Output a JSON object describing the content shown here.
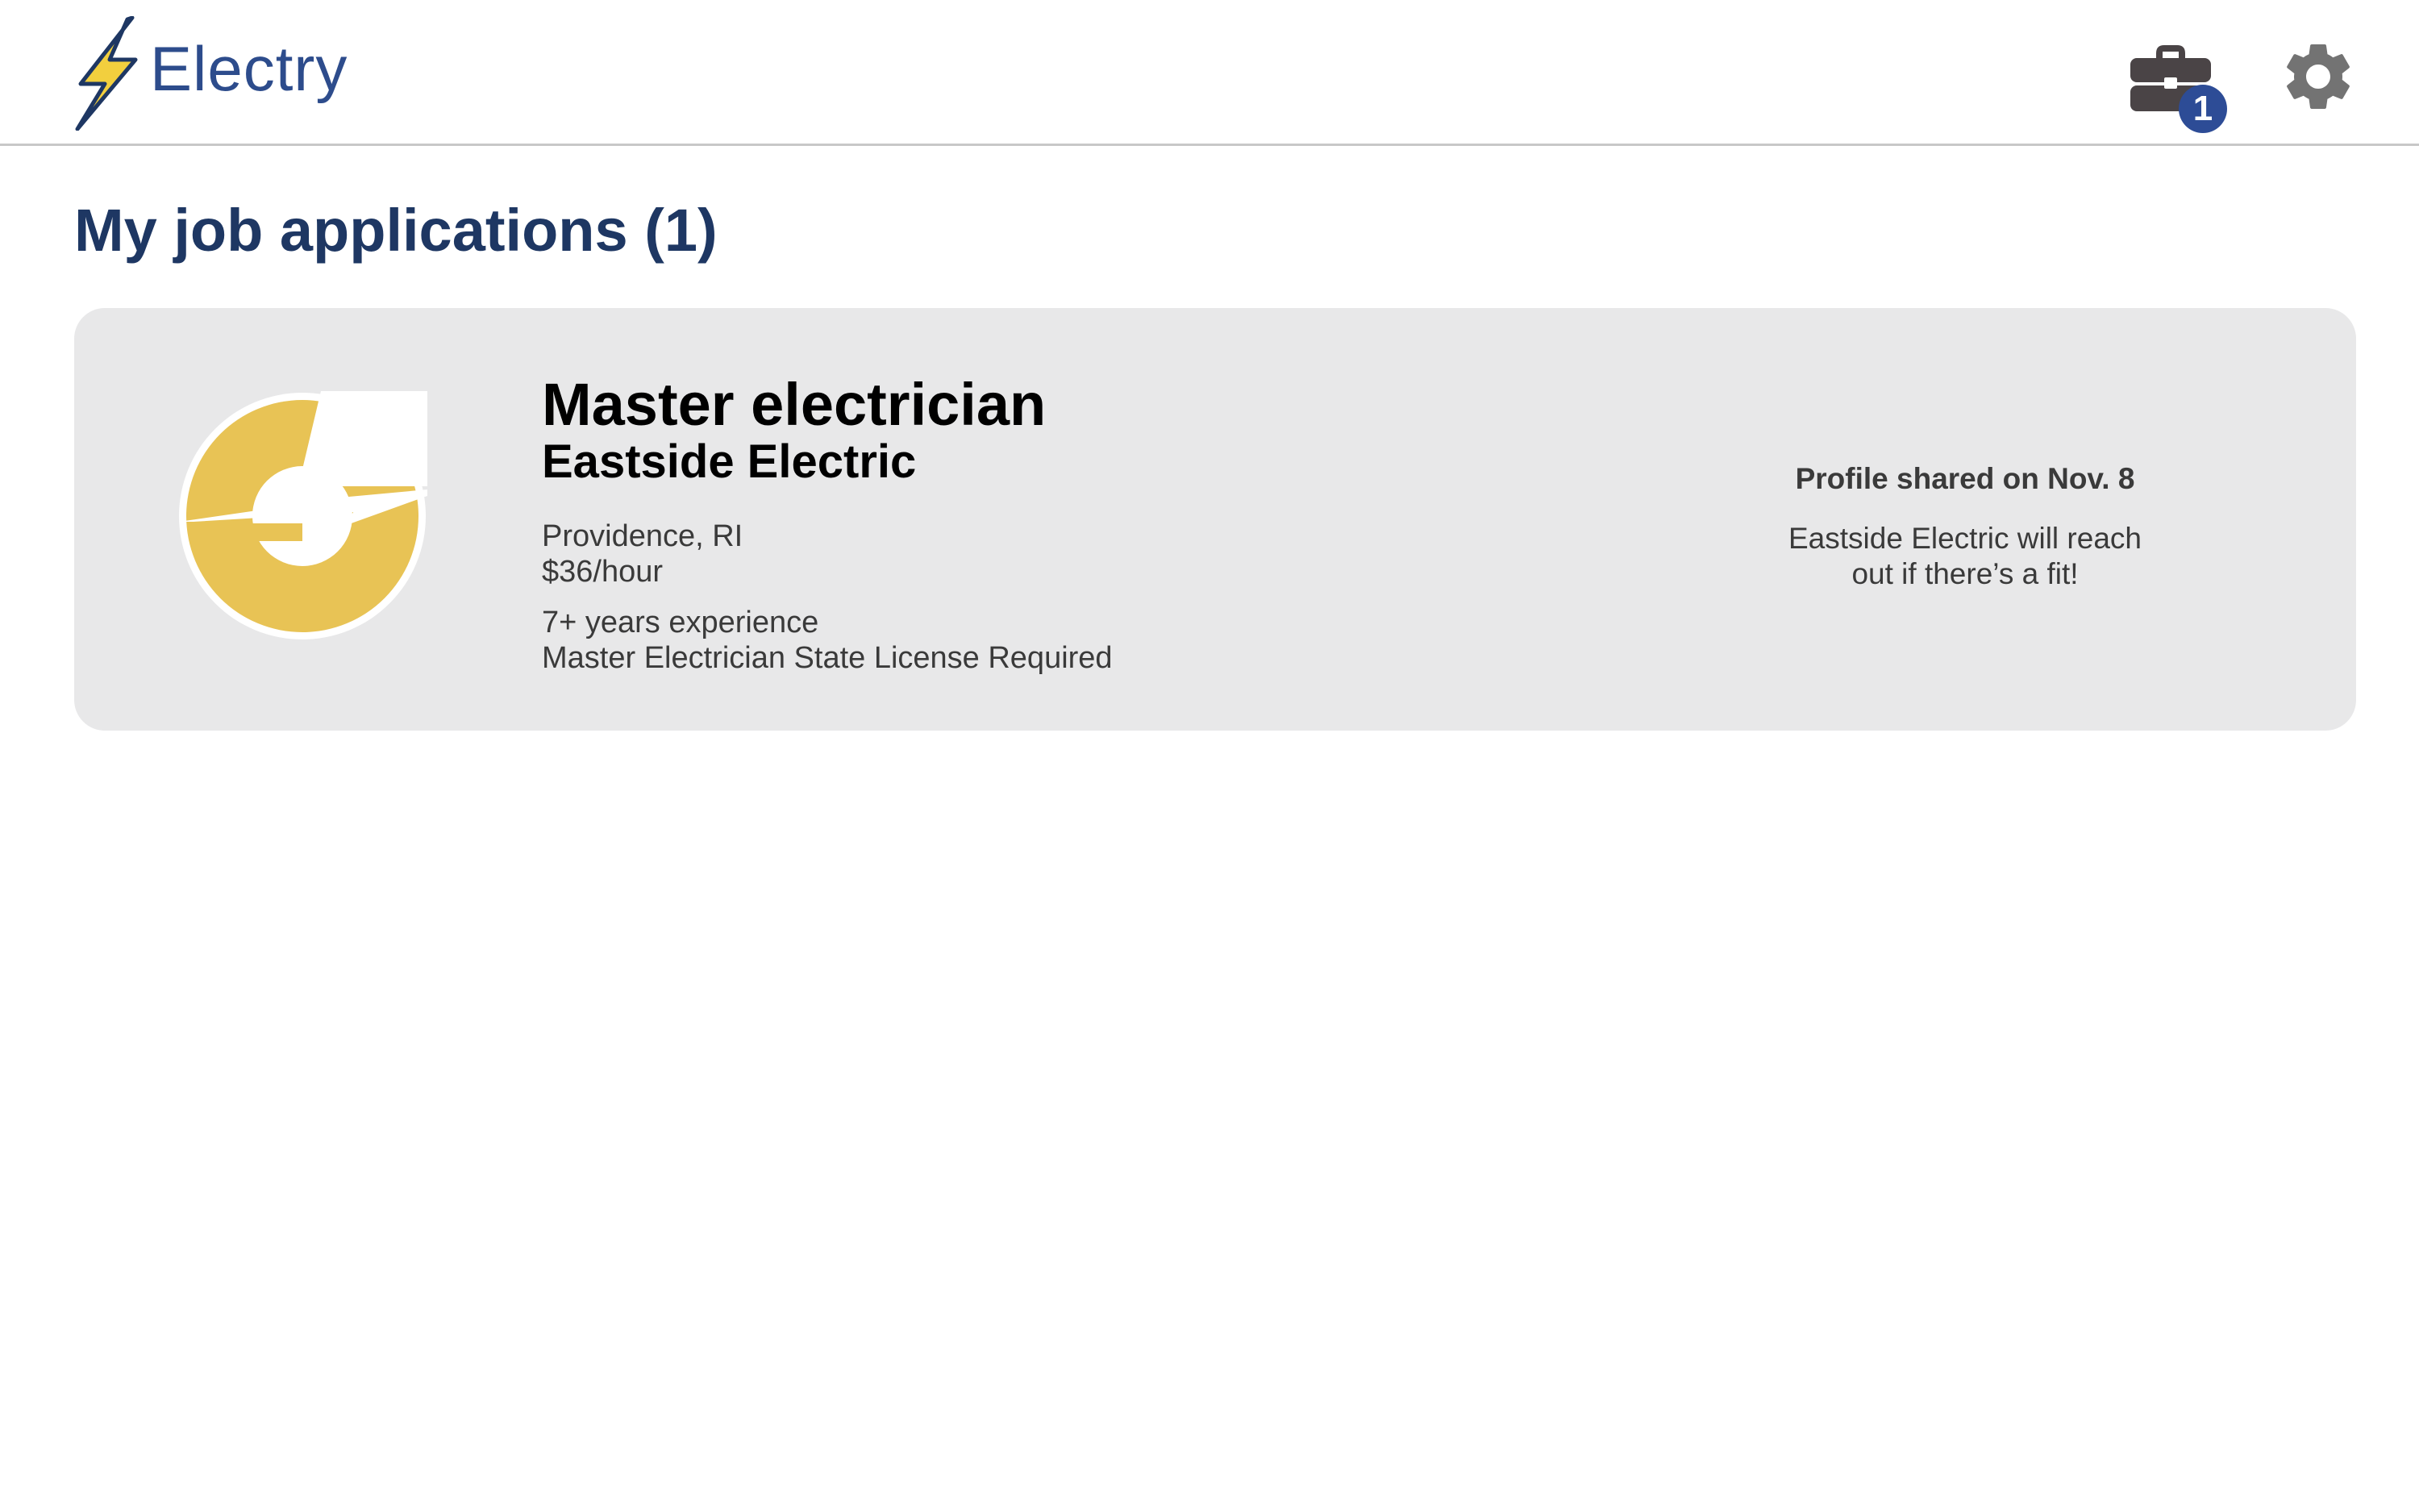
{
  "app": {
    "brand": "Electry",
    "icons": {
      "logo": "lightning-bolt-icon",
      "jobs": "briefcase-icon",
      "settings": "gear-icon"
    }
  },
  "header": {
    "applications_badge": "1"
  },
  "page": {
    "title": "My job applications (1)"
  },
  "applications": [
    {
      "job_title": "Master electrician",
      "company": "Eastside Electric",
      "location": "Providence, RI",
      "pay": "$36/hour",
      "experience": "7+ years experience",
      "license": "Master Electrician State License Required",
      "status_title": "Profile shared on Nov. 8",
      "status_message_line1": "Eastside Electric will reach",
      "status_message_line2": "out if there’s a fit!"
    }
  ],
  "colors": {
    "brand_blue": "#2d4c8c",
    "title_navy": "#1e3763",
    "badge_blue": "#2d4c96",
    "bolt_yellow": "#f2cf3e",
    "company_logo_gold": "#e8c355",
    "card_background": "#e8e8e9",
    "icon_dark": "#4a4446",
    "gear_gray": "#737373"
  }
}
